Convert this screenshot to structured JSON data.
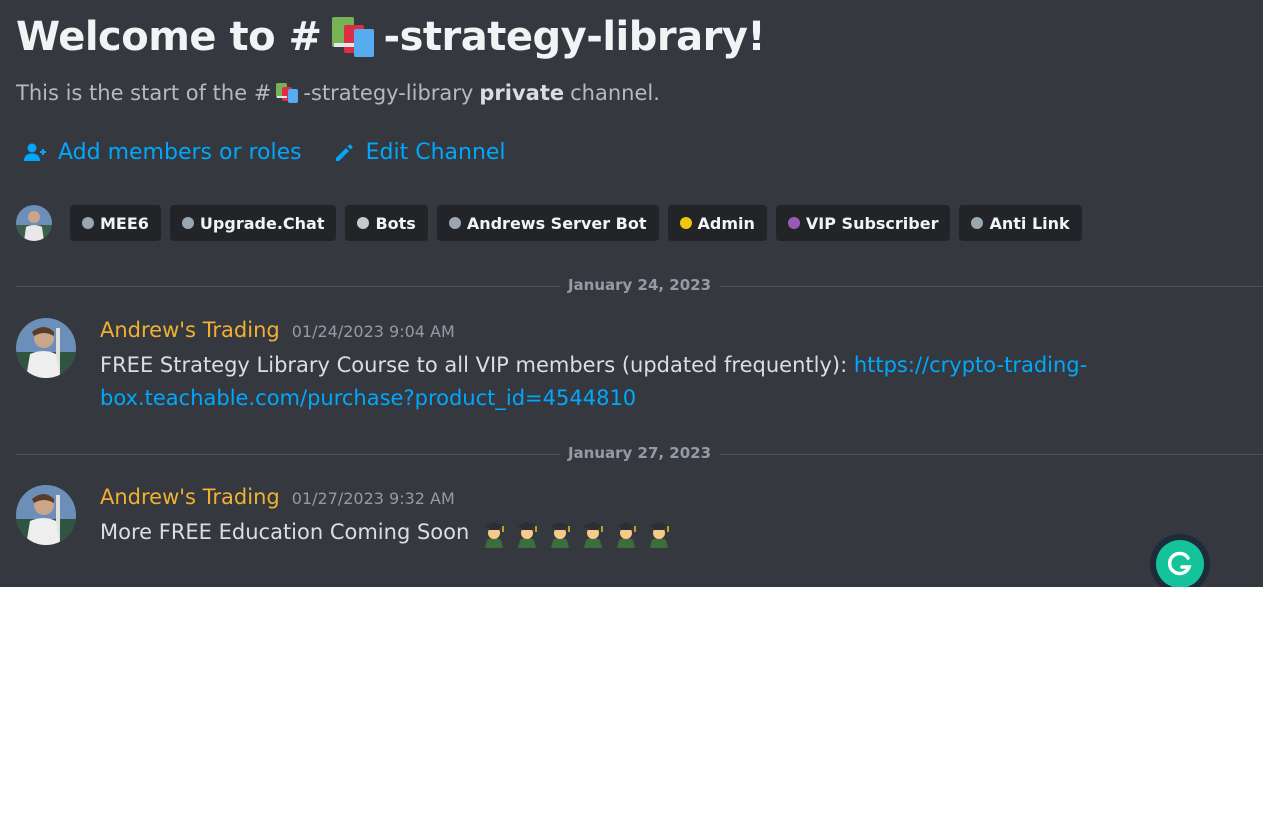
{
  "header": {
    "title_prefix": "Welcome to #",
    "title_suffix": "-strategy-library!",
    "channel_emoji": "books-emoji",
    "subtitle_prefix": "This is the start of the #",
    "subtitle_channel": "-strategy-library",
    "subtitle_private": "private",
    "subtitle_suffix": "channel."
  },
  "actions": {
    "add_members_label": "Add members or roles",
    "add_members_icon": "add-user-icon",
    "edit_channel_label": "Edit Channel",
    "edit_channel_icon": "pencil-icon"
  },
  "roles": [
    {
      "name": "MEE6",
      "color": "#9aa7b1"
    },
    {
      "name": "Upgrade.Chat",
      "color": "#9aa7b1"
    },
    {
      "name": "Bots",
      "color": "#c7c9cc"
    },
    {
      "name": "Andrews Server Bot",
      "color": "#9aa7b1"
    },
    {
      "name": "Admin",
      "color": "#f1c40f"
    },
    {
      "name": "VIP Subscriber",
      "color": "#9b59b6"
    },
    {
      "name": "Anti Link",
      "color": "#9aa7b1"
    }
  ],
  "dividers": [
    "January 24, 2023",
    "January 27, 2023"
  ],
  "messages": [
    {
      "author": "Andrew's Trading",
      "timestamp": "01/24/2023 9:04 AM",
      "text": "FREE Strategy Library Course to all VIP members (updated frequently): ",
      "link": "https://crypto-trading-box.teachable.com/purchase?product_id=4544810"
    },
    {
      "author": "Andrew's Trading",
      "timestamp": "01/27/2023 9:32 AM",
      "text": "More FREE Education Coming Soon",
      "emoji": "graduate-emoji",
      "emoji_count": 6
    }
  ],
  "colors": {
    "background": "#36383f",
    "author": "#f0b132",
    "link": "#00a8fc",
    "chip_bg": "#232428",
    "grammarly": "#15c39a"
  },
  "widgets": {
    "grammarly_icon": "grammarly-icon"
  }
}
